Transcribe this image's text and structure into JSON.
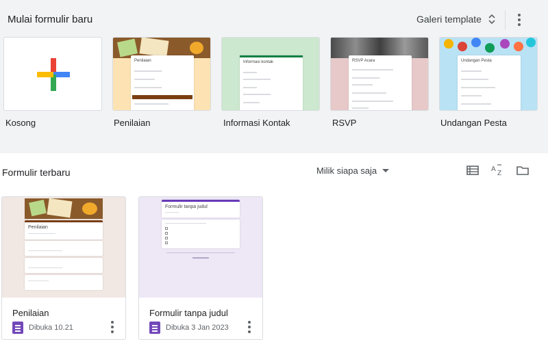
{
  "header": {
    "title": "Mulai formulir baru",
    "gallery_label": "Galeri template"
  },
  "templates": [
    {
      "label": "Kosong"
    },
    {
      "label": "Penilaian",
      "form_title": "Penilaian"
    },
    {
      "label": "Informasi Kontak",
      "form_title": "Informasi kontak"
    },
    {
      "label": "RSVP",
      "form_title": "RSVP Acara"
    },
    {
      "label": "Undangan Pesta",
      "form_title": "Undangan Pesta"
    }
  ],
  "recent": {
    "title": "Formulir terbaru",
    "owner_filter": "Milik siapa saja",
    "items": [
      {
        "title": "Penilaian",
        "opened": "Dibuka 10.21",
        "preview_title": "Penilaian"
      },
      {
        "title": "Formulir tanpa judul",
        "opened": "Dibuka 3 Jan 2023",
        "preview_title": "Formulir tanpa judul"
      }
    ]
  },
  "colors": {
    "forms_purple": "#7248b9",
    "top_bg": "#f1f3f4",
    "plus_red": "#ea4335",
    "plus_blue": "#4285f4",
    "plus_green": "#34a853",
    "plus_yellow": "#fbbc04"
  }
}
